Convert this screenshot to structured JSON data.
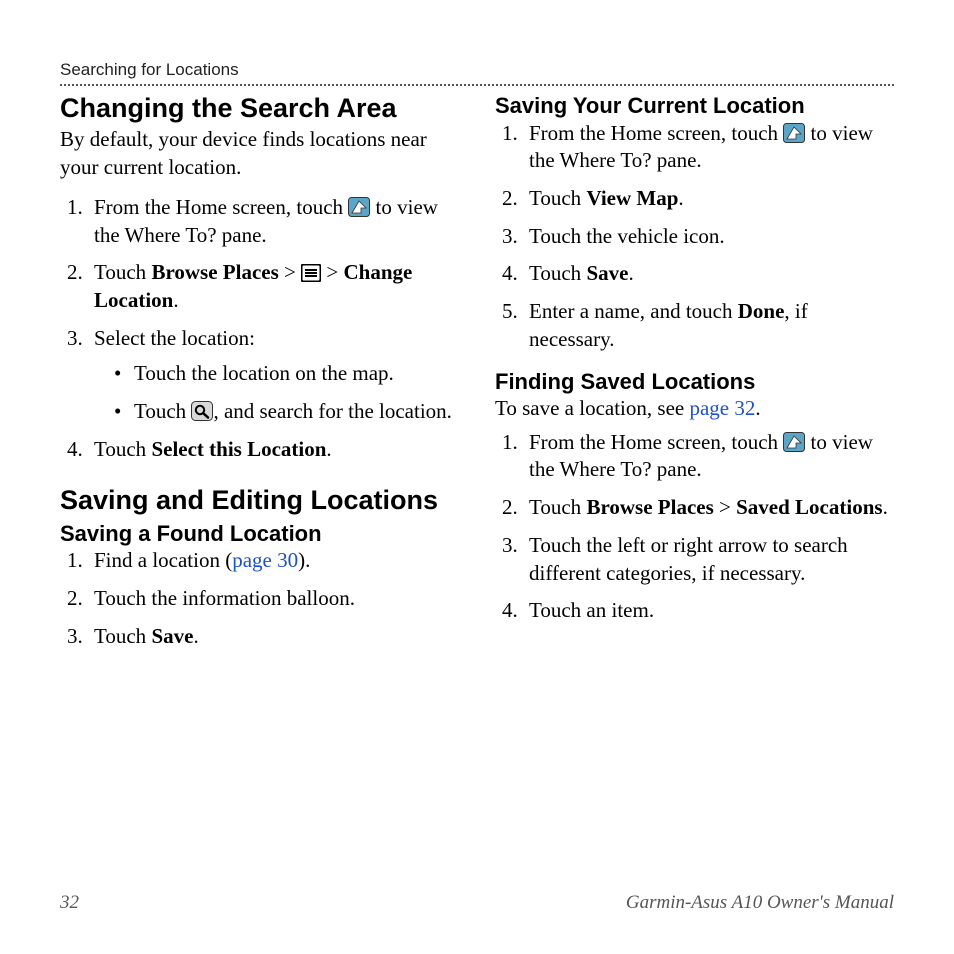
{
  "running_head": "Searching for Locations",
  "left": {
    "h1a": "Changing the Search Area",
    "intro": "By default, your device finds locations near your current location.",
    "step1_a": "From the Home screen, touch ",
    "step1_b": " to view the Where To? pane.",
    "step2_a": "Touch ",
    "step2_b": "Browse Places",
    "step2_c": " > ",
    "step2_d": " > ",
    "step2_e": "Change Location",
    "step2_f": ".",
    "step3": "Select the location:",
    "step3_b1": "Touch the location on the map.",
    "step3_b2_a": "Touch ",
    "step3_b2_b": ", and search for the location.",
    "step4_a": "Touch ",
    "step4_b": "Select this Location",
    "step4_c": ".",
    "h1b": "Saving and Editing Locations",
    "h2a": "Saving a Found Location",
    "sfl1_a": "Find a location (",
    "sfl1_link": "page 30",
    "sfl1_b": ").",
    "sfl2": "Touch the information balloon.",
    "sfl3_a": "Touch ",
    "sfl3_b": "Save",
    "sfl3_c": "."
  },
  "right": {
    "h2a": "Saving Your Current Location",
    "s1_a": "From the Home screen, touch ",
    "s1_b": " to view the Where To? pane.",
    "s2_a": "Touch ",
    "s2_b": "View Map",
    "s2_c": ".",
    "s3": "Touch the vehicle icon.",
    "s4_a": "Touch ",
    "s4_b": "Save",
    "s4_c": ".",
    "s5_a": "Enter a name, and touch ",
    "s5_b": "Done",
    "s5_c": ", if necessary.",
    "h2b": "Finding Saved Locations",
    "fsl_intro_a": "To save a location, see ",
    "fsl_intro_link": "page 32",
    "fsl_intro_b": ".",
    "f1_a": "From the Home screen, touch ",
    "f1_b": " to view the Where To? pane.",
    "f2_a": "Touch ",
    "f2_b": "Browse Places",
    "f2_c": " > ",
    "f2_d": "Saved Locations",
    "f2_e": ".",
    "f3": "Touch the left or right arrow to search different categories, if necessary.",
    "f4": "Touch an item."
  },
  "footer": {
    "page": "32",
    "title": "Garmin-Asus A10 Owner's Manual"
  }
}
